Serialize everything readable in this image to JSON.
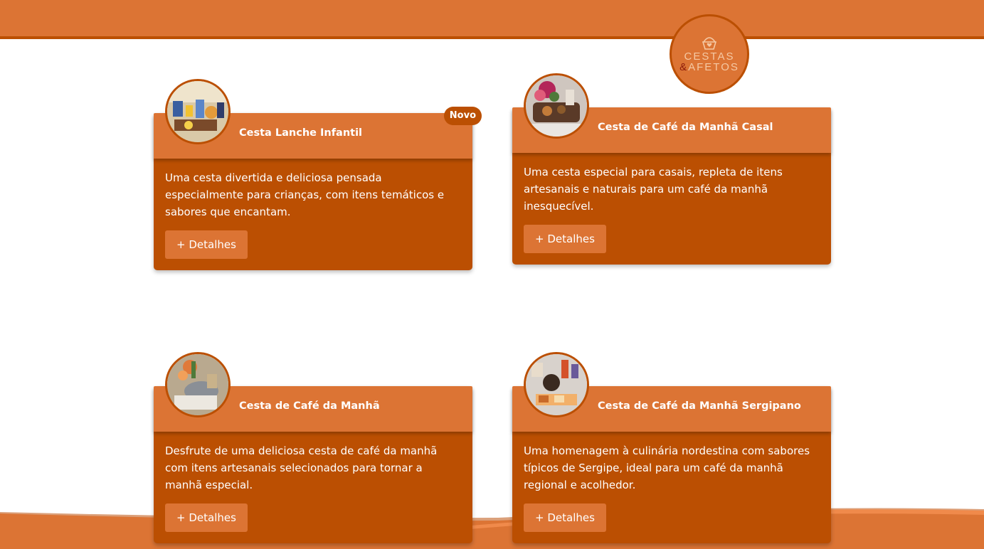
{
  "brand": {
    "logo_line1": "CESTAS",
    "logo_amp": "&",
    "logo_line2": "AFETOS",
    "logo_icon": "basket-heart-icon"
  },
  "colors": {
    "primary": "#dc7434",
    "dark": "#bb4f02",
    "background": "#ffffff"
  },
  "cards": [
    {
      "title": "Cesta Lanche Infantil",
      "badge": "Novo",
      "description": "Uma cesta divertida e deliciosa pensada especialmente para crianças, com itens temáticos e sabores que encantam.",
      "button_label": "+ Detalhes",
      "image": "kids-snack-basket-photo"
    },
    {
      "title": "Cesta de Café da Manhã Casal",
      "description": "Uma cesta especial para casais, repleta de itens artesanais e naturais para um café da manhã inesquecível.",
      "button_label": "+ Detalhes",
      "image": "couple-breakfast-basket-photo"
    },
    {
      "title": "Cesta de Café da Manhã",
      "description": "Desfrute de uma deliciosa cesta de café da manhã com itens artesanais selecionados para tornar a manhã especial.",
      "button_label": "+ Detalhes",
      "image": "breakfast-basket-photo"
    },
    {
      "title": "Cesta de Café da Manhã Sergipano",
      "description": "Uma homenagem à culinária nordestina com sabores típicos de Sergipe, ideal para um café da manhã regional e acolhedor.",
      "button_label": "+ Detalhes",
      "image": "sergipe-breakfast-basket-photo"
    }
  ]
}
